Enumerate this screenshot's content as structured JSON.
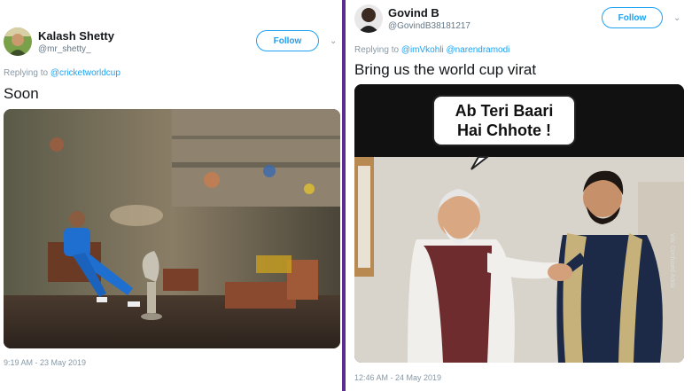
{
  "left_tweet": {
    "author_name": "Kalash Shetty",
    "author_handle": "@mr_shetty_",
    "follow_label": "Follow",
    "menu_icon": "chevron-down-icon",
    "replying_prefix": "Replying to",
    "replying_to": "@cricketworldcup",
    "text": "Soon",
    "timestamp": "9:19 AM - 23 May 2019",
    "media_icon": "cricketer-with-trophy-photo"
  },
  "right_tweet": {
    "author_name": "Govind B",
    "author_handle": "@GovindB38181217",
    "follow_label": "Follow",
    "menu_icon": "chevron-down-icon",
    "replying_prefix": "Replying to",
    "replying_to": "@imVkohli @narendramodi",
    "text": "Bring us the world cup virat",
    "meme_line1": "Ab Teri Baari",
    "meme_line2": "Hai Chhote !",
    "watermark": "Via: Confused Adda",
    "timestamp": "12:46 AM - 24 May 2019",
    "media_icon": "handshake-meme-photo"
  },
  "colors": {
    "follow": "#1da1f2",
    "divider": "#5b2d8e",
    "meme_background": "#111111"
  }
}
